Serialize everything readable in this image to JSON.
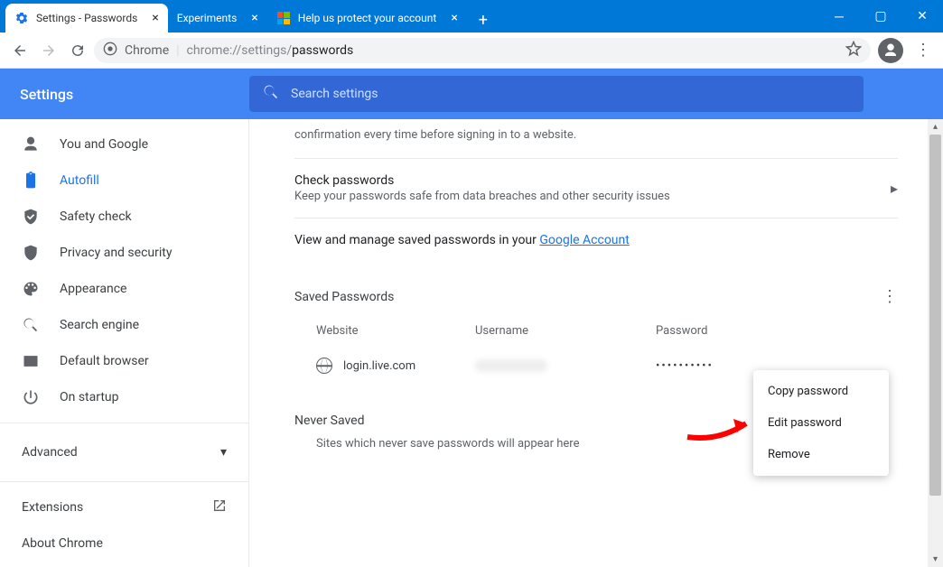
{
  "window": {
    "tabs": [
      {
        "title": "Settings - Passwords"
      },
      {
        "title": "Experiments"
      },
      {
        "title": "Help us protect your account"
      }
    ]
  },
  "addressbar": {
    "scheme": "Chrome",
    "url_prefix": "chrome://settings/",
    "url_path": "passwords"
  },
  "settings": {
    "title": "Settings",
    "search_placeholder": "Search settings",
    "sidebar": {
      "items": [
        {
          "label": "You and Google"
        },
        {
          "label": "Autofill"
        },
        {
          "label": "Safety check"
        },
        {
          "label": "Privacy and security"
        },
        {
          "label": "Appearance"
        },
        {
          "label": "Search engine"
        },
        {
          "label": "Default browser"
        },
        {
          "label": "On startup"
        }
      ],
      "advanced": "Advanced",
      "extensions": "Extensions",
      "about": "About Chrome"
    }
  },
  "main": {
    "truncated_line": "confirmation every time before signing in to a website.",
    "check": {
      "title": "Check passwords",
      "sub": "Keep your passwords safe from data breaches and other security issues"
    },
    "manage": {
      "pre": "View and manage saved passwords in your ",
      "link": "Google Account"
    },
    "saved": {
      "title": "Saved Passwords",
      "headers": {
        "website": "Website",
        "username": "Username",
        "password": "Password"
      },
      "row": {
        "site": "login.live.com",
        "password_mask": "••••••••••"
      }
    },
    "never": {
      "title": "Never Saved",
      "sub": "Sites which never save passwords will appear here"
    }
  },
  "context_menu": {
    "items": [
      {
        "label": "Copy password"
      },
      {
        "label": "Edit password"
      },
      {
        "label": "Remove"
      }
    ]
  }
}
